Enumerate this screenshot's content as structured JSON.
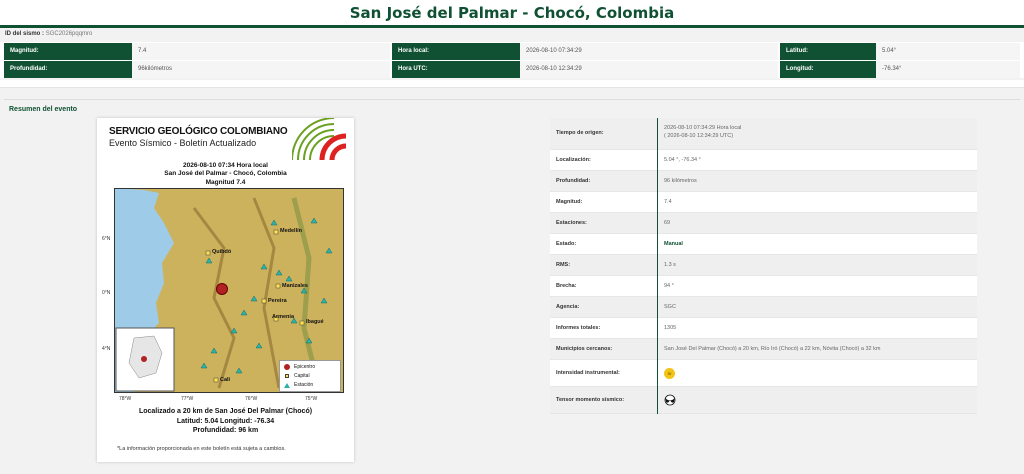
{
  "header": {
    "title": "San José del Palmar - Chocó, Colombia"
  },
  "event_id": {
    "label": "ID del sismo :",
    "value": "SGC2026pqqmro"
  },
  "summary_grid": [
    {
      "label": "Magnitud:",
      "value": "7.4"
    },
    {
      "label": "Hora local:",
      "value": "2026-08-10 07:34:29"
    },
    {
      "label": "Latitud:",
      "value": "5.04°"
    },
    {
      "label": "Profundidad:",
      "value": "96kilómetros"
    },
    {
      "label": "Hora UTC:",
      "value": "2026-08-10 12:34:29"
    },
    {
      "label": "Longitud:",
      "value": "-76.34°"
    }
  ],
  "section_title": "Resumen del evento",
  "bulletin": {
    "org": "SERVICIO GEOLÓGICO COLOMBIANO",
    "subtitle": "Evento Sísmico - Boletín Actualizado",
    "datetime": "2026-08-10 07:34 Hora local",
    "place": "San José del Palmar - Chocó, Colombia",
    "magnitude": "Magnitud 7.4",
    "lat_labels": [
      "6°N",
      "0°N",
      "4°N"
    ],
    "lon_labels": [
      "78°W",
      "77°W",
      "76°W",
      "75°W"
    ],
    "cities": [
      "Medellín",
      "Quibdó",
      "Manizales",
      "Pereira",
      "Armenia",
      "Ibagué",
      "Cali"
    ],
    "legend": [
      "Epicentro",
      "Capital",
      "Estación"
    ],
    "location_text": "Localizado a 20 km de San José Del Palmar (Chocó)",
    "latlon_text": "Latitud: 5.04 Longitud: -76.34",
    "depth_text": "Profundidad: 96 km",
    "note": "*La información proporcionada en este boletín está sujeta a cambios."
  },
  "details": [
    {
      "label": "Tiempo de origen:",
      "value": "2026-08-10 07:34:29 Hora local",
      "value2": "( 2026-08-10 12:34:29 UTC)"
    },
    {
      "label": "Localización:",
      "value": "5.04 °, -76.34 °"
    },
    {
      "label": "Profundidad:",
      "value": "96 kilómetros"
    },
    {
      "label": "Magnitud:",
      "value": "7.4"
    },
    {
      "label": "Estaciones:",
      "value": "69"
    },
    {
      "label": "Estado:",
      "value": "Manual"
    },
    {
      "label": "RMS:",
      "value": "1.3 s"
    },
    {
      "label": "Brecha:",
      "value": "94 °"
    },
    {
      "label": "Agencia:",
      "value": "SGC"
    },
    {
      "label": "Informes totales:",
      "value": "1305"
    },
    {
      "label": "Municipios cercanos:",
      "value": "San José Del Palmar (Chocó) a 20 km, Río Iró (Chocó) a 22 km, Nóvita (Chocó) a 32 km"
    },
    {
      "label": "Intensidad instrumental:",
      "value": ""
    },
    {
      "label": "Tensor momento sísmico:",
      "value": ""
    }
  ],
  "colors": {
    "brand": "#0f5132",
    "epicenter": "#b22222",
    "intensity": "#f2c418"
  }
}
